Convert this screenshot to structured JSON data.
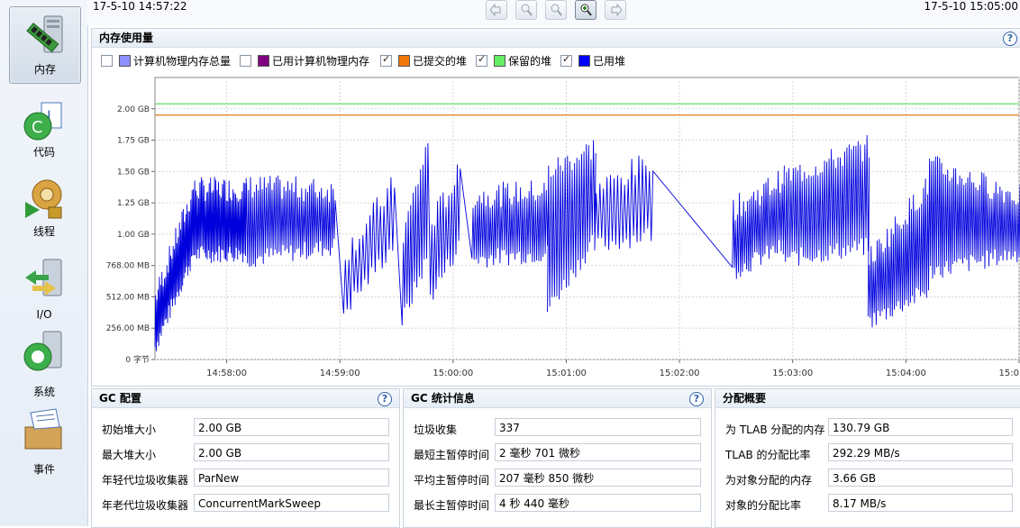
{
  "nav": {
    "items": [
      {
        "label": "内存",
        "icon": "memory-icon",
        "selected": true
      },
      {
        "label": "代码",
        "icon": "code-icon",
        "selected": false
      },
      {
        "label": "线程",
        "icon": "threads-icon",
        "selected": false
      },
      {
        "label": "I/O",
        "icon": "io-icon",
        "selected": false
      },
      {
        "label": "系统",
        "icon": "system-icon",
        "selected": false
      },
      {
        "label": "事件",
        "icon": "events-icon",
        "selected": false
      }
    ]
  },
  "toolbar": {
    "start_time": "17-5-10 14:57:22",
    "end_time": "17-5-10 15:05:00",
    "buttons": [
      "back-icon",
      "zoom-out-icon",
      "zoom-reset-icon",
      "zoom-in-icon",
      "forward-icon"
    ]
  },
  "memory_panel": {
    "title": "内存使用量",
    "help": "?",
    "legend": [
      {
        "label": "计算机物理内存总量",
        "checked": false,
        "color": "#8f8fff"
      },
      {
        "label": "已用计算机物理内存",
        "checked": false,
        "color": "#800080"
      },
      {
        "label": "已提交的堆",
        "checked": true,
        "color": "#f0780a"
      },
      {
        "label": "保留的堆",
        "checked": true,
        "color": "#66ee66"
      },
      {
        "label": "已用堆",
        "checked": true,
        "color": "#0000ff"
      }
    ]
  },
  "chart_data": {
    "type": "line",
    "title": "",
    "y_tick_labels": [
      "0 字节",
      "256.00 MB",
      "512.00 MB",
      "768.00 MB",
      "1.00 GB",
      "1.25 GB",
      "1.50 GB",
      "1.75 GB",
      "2.00 GB"
    ],
    "x_tick_labels": [
      "14:58:00",
      "14:59:00",
      "15:00:00",
      "15:01:00",
      "15:02:00",
      "15:03:00",
      "15:04:00",
      "15:05:00"
    ],
    "ylim_gb": [
      0,
      2.25
    ],
    "xlim_time": [
      "14:57:22",
      "15:05:00"
    ],
    "grid": true,
    "series": [
      {
        "name": "保留的堆",
        "color": "#66dd66",
        "constant_gb": 2.04
      },
      {
        "name": "已提交的堆",
        "color": "#e07818",
        "constant_gb": 1.95
      },
      {
        "name": "已用堆",
        "color": "#0000dd",
        "segments": [
          {
            "t0": "14:57:22",
            "t1": "14:57:42",
            "low0": 0.1,
            "low1": 0.82,
            "high0": 0.5,
            "high1": 1.35,
            "cycles": 30
          },
          {
            "t0": "14:57:42",
            "t1": "14:58:10",
            "low0": 0.84,
            "low1": 0.85,
            "high0": 1.36,
            "high1": 1.36,
            "cycles": 40
          },
          {
            "t0": "14:58:10",
            "t1": "14:58:57",
            "low0": 0.8,
            "low1": 0.9,
            "high0": 1.38,
            "high1": 1.35,
            "cycles": 45
          },
          {
            "t0": "14:59:02",
            "t1": "14:59:28",
            "low0": 0.38,
            "low1": 0.9,
            "high0": 0.85,
            "high1": 1.4,
            "cycles": 14
          },
          {
            "t0": "14:59:33",
            "t1": "14:59:46",
            "low0": 0.3,
            "low1": 0.8,
            "high0": 1.0,
            "high1": 1.72,
            "cycles": 10
          },
          {
            "t0": "14:59:48",
            "t1": "15:00:03",
            "low0": 0.5,
            "low1": 0.9,
            "high0": 1.1,
            "high1": 1.5,
            "cycles": 10
          },
          {
            "t0": "15:00:10",
            "t1": "15:00:50",
            "low0": 0.8,
            "low1": 0.85,
            "high0": 1.3,
            "high1": 1.35,
            "cycles": 35
          },
          {
            "t0": "15:00:50",
            "t1": "15:01:15",
            "low0": 0.4,
            "low1": 0.95,
            "high0": 1.5,
            "high1": 1.7,
            "cycles": 20
          },
          {
            "t0": "15:01:15",
            "t1": "15:01:45",
            "low0": 0.9,
            "low1": 1.0,
            "high0": 1.35,
            "high1": 1.6,
            "cycles": 16
          },
          {
            "t0": "15:02:28",
            "t1": "15:02:55",
            "low0": 0.7,
            "low1": 0.9,
            "high0": 1.2,
            "high1": 1.45,
            "cycles": 25
          },
          {
            "t0": "15:02:55",
            "t1": "15:03:40",
            "low0": 0.8,
            "low1": 0.9,
            "high0": 1.45,
            "high1": 1.7,
            "cycles": 38
          },
          {
            "t0": "15:03:40",
            "t1": "15:04:12",
            "low0": 0.3,
            "low1": 0.55,
            "high0": 0.8,
            "high1": 1.4,
            "cycles": 30
          },
          {
            "t0": "15:04:12",
            "t1": "15:05:00",
            "low0": 0.7,
            "low1": 0.85,
            "high0": 1.55,
            "high1": 1.3,
            "cycles": 45
          }
        ]
      }
    ]
  },
  "gc_config": {
    "title": "GC 配置",
    "help": "?",
    "rows": [
      {
        "label": "初始堆大小",
        "value": "2.00 GB"
      },
      {
        "label": "最大堆大小",
        "value": "2.00 GB"
      },
      {
        "label": "年轻代垃圾收集器",
        "value": "ParNew"
      },
      {
        "label": "年老代垃圾收集器",
        "value": "ConcurrentMarkSweep"
      }
    ]
  },
  "gc_stats": {
    "title": "GC 统计信息",
    "help": "?",
    "rows": [
      {
        "label": "垃圾收集",
        "value": "337"
      },
      {
        "label": "最短主暂停时间",
        "value": "2 毫秒 701 微秒"
      },
      {
        "label": "平均主暂停时间",
        "value": "207 毫秒 850 微秒"
      },
      {
        "label": "最长主暂停时间",
        "value": "4 秒 440 毫秒"
      }
    ]
  },
  "alloc_summary": {
    "title": "分配概要",
    "rows": [
      {
        "label": "为 TLAB 分配的内存",
        "value": "130.79 GB"
      },
      {
        "label": "TLAB 的分配比率",
        "value": "292.29 MB/s"
      },
      {
        "label": "为对象分配的内存",
        "value": "3.66 GB"
      },
      {
        "label": "对象的分配比率",
        "value": "8.17 MB/s"
      }
    ]
  }
}
